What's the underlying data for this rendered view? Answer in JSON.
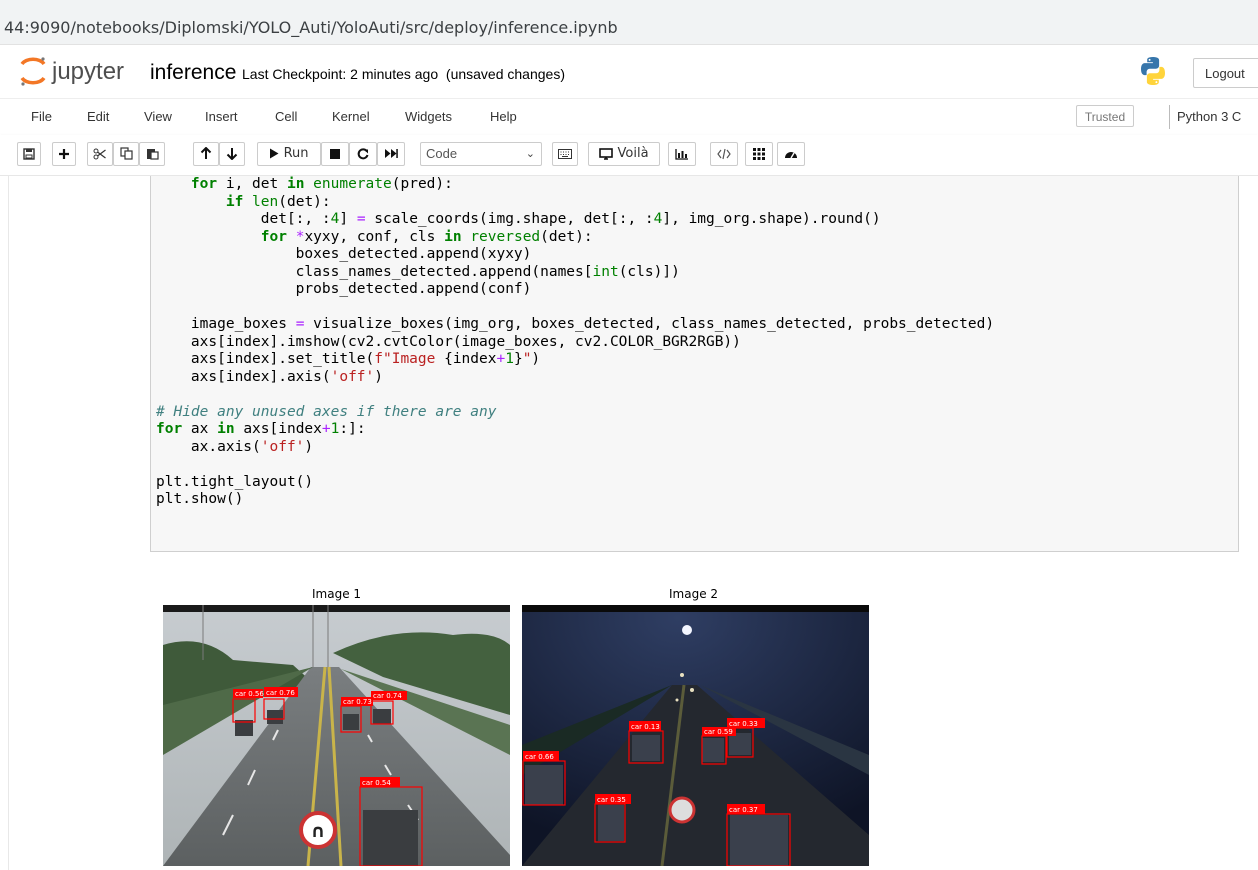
{
  "browser": {
    "url": "44:9090/notebooks/Diplomski/YOLO_Auti/YoloAuti/src/deploy/inference.ipynb"
  },
  "header": {
    "logo_text": "jupyter",
    "notebook_name": "inference",
    "checkpoint": "Last Checkpoint: 2 minutes ago",
    "unsaved": "(unsaved changes)",
    "logout": "Logout"
  },
  "menubar": {
    "items": [
      "File",
      "Edit",
      "View",
      "Insert",
      "Cell",
      "Kernel",
      "Widgets",
      "Help"
    ],
    "trusted": "Trusted",
    "kernel": "Python 3 C"
  },
  "toolbar": {
    "run_label": "Run",
    "cell_type": "Code",
    "voila_label": "Voilà",
    "icons": [
      "save-icon",
      "insert-cell-icon",
      "cut-icon",
      "copy-icon",
      "paste-icon",
      "move-up-icon",
      "move-down-icon",
      "run-icon",
      "stop-icon",
      "restart-icon",
      "fast-forward-icon",
      "keyboard-icon",
      "voila-icon",
      "chart-icon",
      "code-icon",
      "grid-icon",
      "gauge-icon"
    ]
  },
  "code_lines": [
    "    for i, det in enumerate(pred):",
    "        if len(det):",
    "            det[:, :4] = scale_coords(img.shape, det[:, :4], img_org.shape).round()",
    "            for *xyxy, conf, cls in reversed(det):",
    "                boxes_detected.append(xyxy)",
    "                class_names_detected.append(names[int(cls)])",
    "                probs_detected.append(conf)",
    "",
    "    image_boxes = visualize_boxes(img_org, boxes_detected, class_names_detected, probs_detected)",
    "    axs[index].imshow(cv2.cvtColor(image_boxes, cv2.COLOR_BGR2RGB))",
    "    axs[index].set_title(f\"Image {index+1}\")",
    "    axs[index].axis('off')",
    "",
    "# Hide any unused axes if there are any",
    "for ax in axs[index+1:]:",
    "    ax.axis('off')",
    "",
    "plt.tight_layout()",
    "plt.show()"
  ],
  "output": {
    "images": [
      {
        "title": "Image 1",
        "detections": [
          "car 0.56",
          "car 0.76",
          "car 0.73",
          "car 0.74",
          "car 0.54"
        ]
      },
      {
        "title": "Image 2",
        "detections": [
          "car 0.13",
          "car 0.33",
          "car 0.59",
          "car 0.66",
          "car 0.35",
          "car 0.37"
        ]
      }
    ]
  },
  "colors": {
    "jupyter_orange": "#f37726",
    "keyword_green": "#008000",
    "string_red": "#ba2121",
    "comment_teal": "#408080",
    "detection_box": "#ff0000"
  }
}
